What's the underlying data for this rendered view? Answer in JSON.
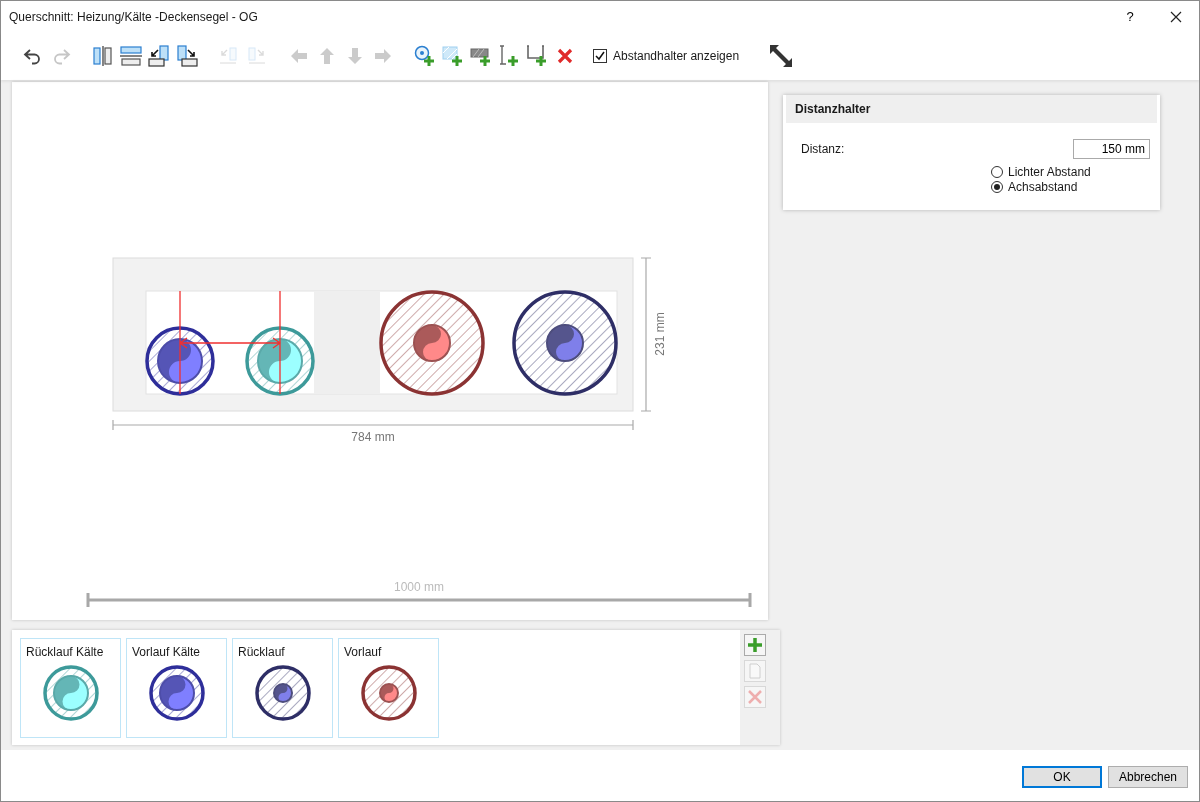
{
  "window": {
    "title": "Querschnitt: Heizung/Kälte -Deckensegel - OG",
    "help": "?"
  },
  "toolbar": {
    "buttons": [
      {
        "disabled": false
      },
      {
        "disabled": true
      },
      {
        "disabled": false
      },
      {
        "disabled": false
      },
      {
        "disabled": false
      },
      {
        "disabled": false
      },
      {
        "disabled": true
      },
      {
        "disabled": true
      },
      {
        "disabled": true
      },
      {
        "disabled": true
      },
      {
        "disabled": true
      },
      {
        "disabled": true
      },
      {
        "disabled": false
      },
      {
        "disabled": false
      },
      {
        "disabled": false
      },
      {
        "disabled": false
      },
      {
        "disabled": false
      },
      {
        "disabled": false
      }
    ],
    "show_spacers": {
      "label": "Abstandhalter anzeigen",
      "checked": true
    }
  },
  "section": {
    "pipes": [
      {
        "color": "#2e2e9a",
        "kind": "large-core"
      },
      {
        "color": "#3d9a9a",
        "kind": "large-core"
      },
      {
        "color": "#8b3333",
        "kind": "small-core"
      },
      {
        "color": "#2e2e66",
        "kind": "small-core"
      }
    ],
    "width_label": "784 mm",
    "height_label": "231 mm",
    "total_label": "1000 mm"
  },
  "properties": {
    "title": "Distanzhalter",
    "distance_label": "Distanz:",
    "distance_value": "150 mm",
    "options": [
      {
        "label": "Lichter Abstand",
        "selected": false
      },
      {
        "label": "Achsabstand",
        "selected": true
      }
    ]
  },
  "palette": {
    "items": [
      {
        "label": "Rücklauf Kälte",
        "color": "#3d9a9a",
        "kind": "large-core"
      },
      {
        "label": "Vorlauf Kälte",
        "color": "#2e2e9a",
        "kind": "large-core"
      },
      {
        "label": "Rücklauf",
        "color": "#2e2e66",
        "kind": "small-core"
      },
      {
        "label": "Vorlauf",
        "color": "#8b3333",
        "kind": "small-core"
      }
    ],
    "actions": [
      {
        "disabled": false
      },
      {
        "disabled": true
      },
      {
        "disabled": true
      }
    ]
  },
  "footer": {
    "buttons": [
      "OK",
      "Abbrechen"
    ]
  }
}
